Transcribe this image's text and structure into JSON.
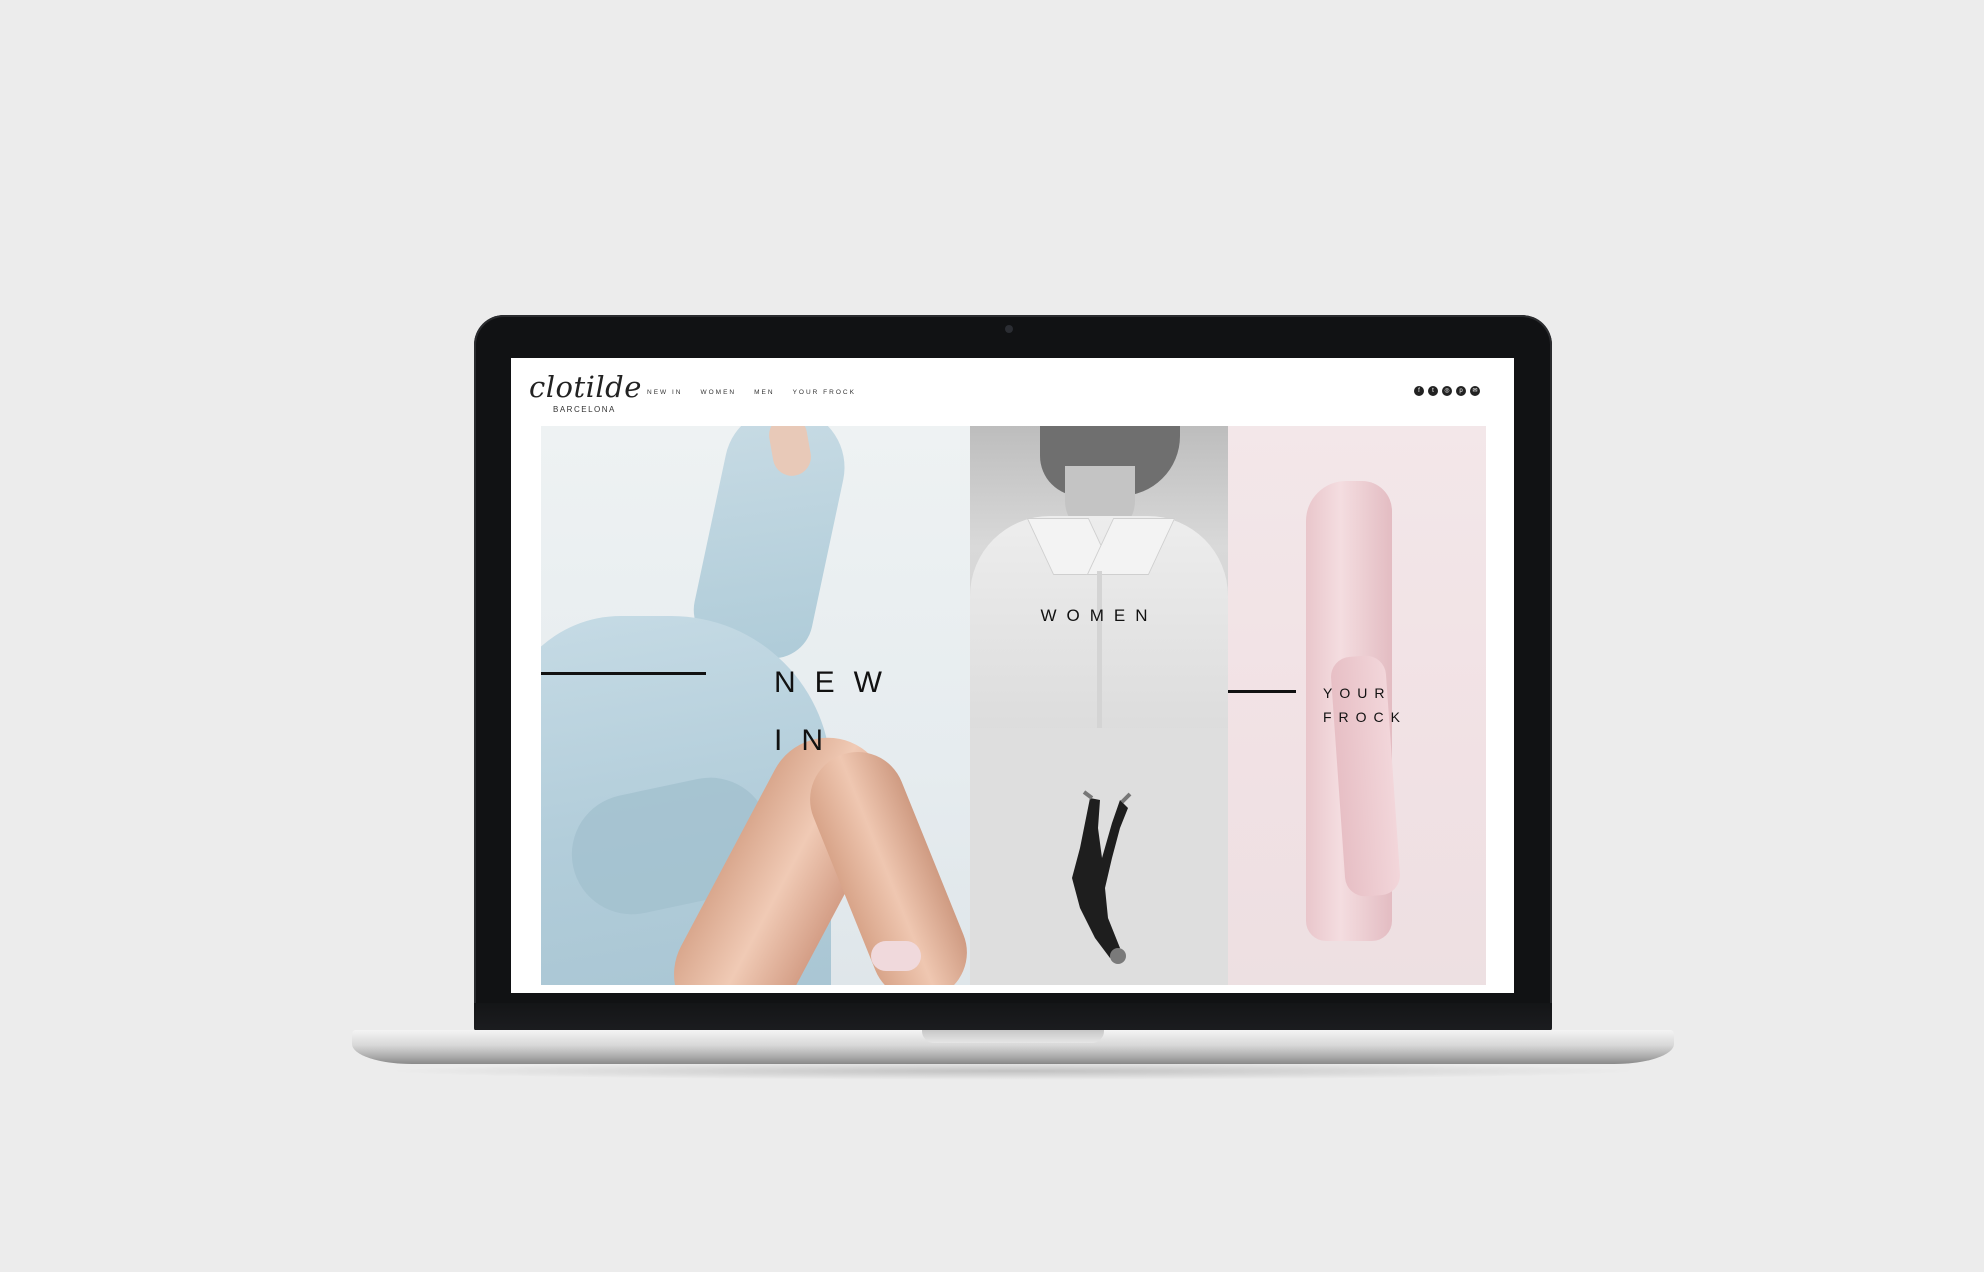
{
  "site": {
    "logo": "clotilde",
    "logo_sub": "BARCELONA",
    "nav": [
      "NEW IN",
      "WOMEN",
      "MEN",
      "YOUR FROCK"
    ],
    "social_icons": [
      "facebook-icon",
      "twitter-icon",
      "instagram-icon",
      "pinterest-icon",
      "mail-icon"
    ]
  },
  "panels": {
    "new_in": {
      "line1": "NEW",
      "line2": "IN"
    },
    "women": {
      "label": "WOMEN"
    },
    "your_frock": {
      "line1": "YOUR",
      "line2": "FROCK"
    }
  },
  "colors": {
    "background": "#ececec",
    "laptop_bezel": "#111214",
    "new_in_accent": "#b2cdda",
    "frock_accent": "#f3e7e9",
    "text": "#111111"
  }
}
